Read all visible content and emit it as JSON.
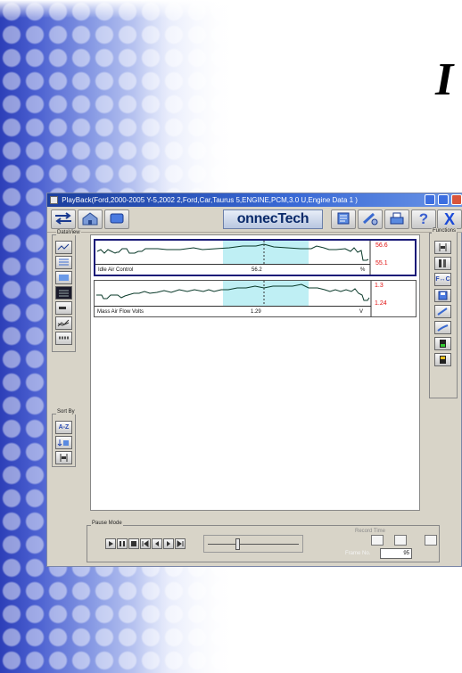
{
  "slide": {
    "letter": "I"
  },
  "window": {
    "title": "PlayBack(Ford,2000-2005 Y-5,2002 2,Ford,Car,Taurus 5,ENGINE,PCM,3.0 U,Engine Data 1 )"
  },
  "toolbar": {
    "logo": "onnecTech",
    "buttons": [
      "transfer-icon",
      "home-icon",
      "record-icon",
      "notebook-icon",
      "tools-icon",
      "print-icon",
      "help-icon",
      "exit-icon"
    ],
    "help_glyph": "?",
    "exit_glyph": "X"
  },
  "dataview": {
    "label": "DataView",
    "buttons": [
      "graph-view-icon",
      "list-view-icon",
      "meter-view-icon",
      "digital-view-icon",
      "bar-view-icon",
      "multi-graph-icon",
      "grid-view-icon"
    ]
  },
  "sortby": {
    "label": "Sort By",
    "buttons": [
      {
        "icon": "sort-az-icon",
        "text": "A-Z"
      },
      {
        "icon": "sort-user-icon",
        "text": ""
      },
      {
        "icon": "sort-default-icon",
        "text": ""
      }
    ]
  },
  "functions": {
    "label": "Functions",
    "buttons": [
      {
        "icon": "select-pid-icon",
        "text": ""
      },
      {
        "icon": "freeze-icon",
        "text": ""
      },
      {
        "icon": "units-toggle-icon",
        "text": "F↔C"
      },
      {
        "icon": "save-icon",
        "text": ""
      },
      {
        "icon": "zoom-icon",
        "text": ""
      },
      {
        "icon": "edit-icon",
        "text": ""
      },
      {
        "icon": "battery-icon",
        "text": ""
      },
      {
        "icon": "trigger-icon",
        "text": ""
      }
    ]
  },
  "pids": [
    {
      "name": "Idle Air Control",
      "value": "56.2",
      "unit": "%",
      "max": "56.6",
      "min": "55.1",
      "selected": true
    },
    {
      "name": "Mass Air Flow Volts",
      "value": "1.29",
      "unit": "V",
      "max": "1.3",
      "min": "1.24",
      "selected": false
    }
  ],
  "pause_mode": {
    "label": "Pause Mode",
    "controls": [
      "play-icon",
      "pause-icon",
      "stop-icon",
      "rewind-start-icon",
      "step-back-icon",
      "step-forward-icon",
      "fast-forward-icon"
    ],
    "slider_position_fraction": 0.32,
    "record_time_label": "Record Time",
    "frame_label": "Frame No.",
    "frame_no": "95"
  },
  "colors": {
    "titlebar": "#1c3f9e",
    "trace": "#0a3a2a",
    "highlight": "#bfeff4",
    "minmax": "#e01010",
    "selected_border": "#1a1a78"
  }
}
